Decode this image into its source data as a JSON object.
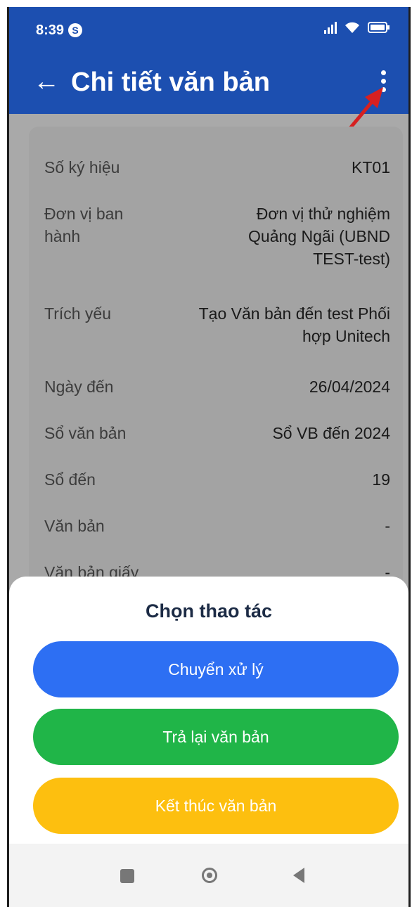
{
  "status_bar": {
    "time": "8:39",
    "app_badge": "S",
    "battery": "99"
  },
  "app_bar": {
    "back_symbol": "←",
    "title": "Chi tiết văn bản"
  },
  "details": [
    {
      "label": "Số ký hiệu",
      "value": "KT01"
    },
    {
      "label": "Đơn vị ban hành",
      "value": "Đơn vị thử nghiệm Quảng Ngãi (UBND TEST-test)"
    },
    {
      "label": "Trích yếu",
      "value": "Tạo Văn bản đến test Phối hợp Unitech"
    },
    {
      "label": "Ngày đến",
      "value": "26/04/2024"
    },
    {
      "label": "Sổ văn bản",
      "value": "Sổ VB đến 2024"
    },
    {
      "label": "Sổ đến",
      "value": "19"
    },
    {
      "label": "Văn bản",
      "value": "-"
    },
    {
      "label": "Văn bản giấy",
      "value": "-"
    }
  ],
  "action_sheet": {
    "title": "Chọn thao tác",
    "actions": [
      {
        "label": "Chuyển xử lý",
        "color": "#2d6ff3"
      },
      {
        "label": "Trả lại văn bản",
        "color": "#20b548"
      },
      {
        "label": "Kết thúc văn bản",
        "color": "#fdbf0f"
      }
    ]
  },
  "colors": {
    "primary": "#1c4fb0",
    "annotation_arrow": "#d62020"
  }
}
